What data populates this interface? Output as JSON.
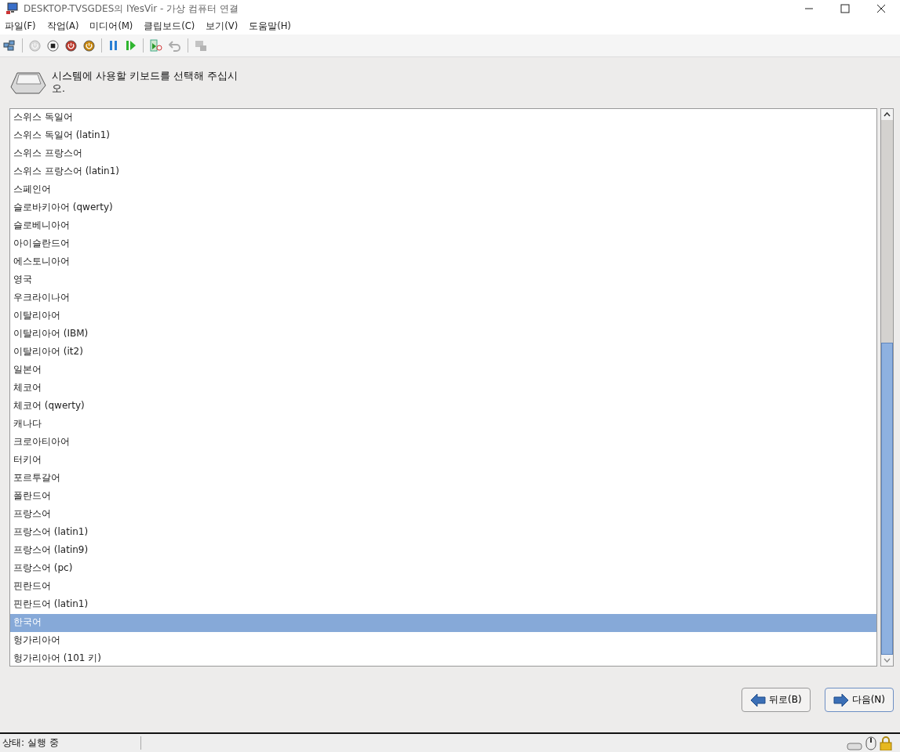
{
  "window": {
    "title": "DESKTOP-TVSGDES의 IYesVir - 가상 컴퓨터 연결"
  },
  "menu": [
    {
      "label": "파일(F)"
    },
    {
      "label": "작업(A)"
    },
    {
      "label": "미디어(M)"
    },
    {
      "label": "클립보드(C)"
    },
    {
      "label": "보기(V)"
    },
    {
      "label": "도움말(H)"
    }
  ],
  "toolbar": [
    {
      "kind": "ctrl-alt-del",
      "disabled": false
    },
    {
      "kind": "sep"
    },
    {
      "kind": "start",
      "disabled": true
    },
    {
      "kind": "save",
      "disabled": false
    },
    {
      "kind": "turn-off",
      "disabled": false
    },
    {
      "kind": "shutdown",
      "disabled": false
    },
    {
      "kind": "sep"
    },
    {
      "kind": "pause",
      "disabled": false
    },
    {
      "kind": "resume",
      "disabled": false
    },
    {
      "kind": "sep"
    },
    {
      "kind": "checkpoint",
      "disabled": false
    },
    {
      "kind": "revert",
      "disabled": true
    },
    {
      "kind": "sep"
    },
    {
      "kind": "enhanced",
      "disabled": true
    }
  ],
  "prompt": "시스템에 사용할 키보드를 선택해 주십시\n오.",
  "keyboards": [
    {
      "label": "스위스 독일어",
      "selected": false
    },
    {
      "label": "스위스 독일어 (latin1)",
      "selected": false
    },
    {
      "label": "스위스 프랑스어",
      "selected": false
    },
    {
      "label": "스위스 프랑스어 (latin1)",
      "selected": false
    },
    {
      "label": "스페인어",
      "selected": false
    },
    {
      "label": "슬로바키아어 (qwerty)",
      "selected": false
    },
    {
      "label": "슬로베니아어",
      "selected": false
    },
    {
      "label": "아이슬란드어",
      "selected": false
    },
    {
      "label": "에스토니아어",
      "selected": false
    },
    {
      "label": "영국",
      "selected": false
    },
    {
      "label": "우크라이나어",
      "selected": false
    },
    {
      "label": "이탈리아어",
      "selected": false
    },
    {
      "label": "이탈리아어 (IBM)",
      "selected": false
    },
    {
      "label": "이탈리아어 (it2)",
      "selected": false
    },
    {
      "label": "일본어",
      "selected": false
    },
    {
      "label": "체코어",
      "selected": false
    },
    {
      "label": "체코어 (qwerty)",
      "selected": false
    },
    {
      "label": "캐나다",
      "selected": false
    },
    {
      "label": "크로아티아어",
      "selected": false
    },
    {
      "label": "터키어",
      "selected": false
    },
    {
      "label": "포르투갈어",
      "selected": false
    },
    {
      "label": "폴란드어",
      "selected": false
    },
    {
      "label": "프랑스어",
      "selected": false
    },
    {
      "label": "프랑스어 (latin1)",
      "selected": false
    },
    {
      "label": "프랑스어 (latin9)",
      "selected": false
    },
    {
      "label": "프랑스어 (pc)",
      "selected": false
    },
    {
      "label": "핀란드어",
      "selected": false
    },
    {
      "label": "핀란드어 (latin1)",
      "selected": false
    },
    {
      "label": "한국어",
      "selected": true
    },
    {
      "label": "헝가리아어",
      "selected": false
    },
    {
      "label": "헝가리아어 (101 키)",
      "selected": false
    }
  ],
  "buttons": {
    "back": "뒤로(B)",
    "next": "다음(N)"
  },
  "status_bar": {
    "text": "상태: 실행 중"
  }
}
